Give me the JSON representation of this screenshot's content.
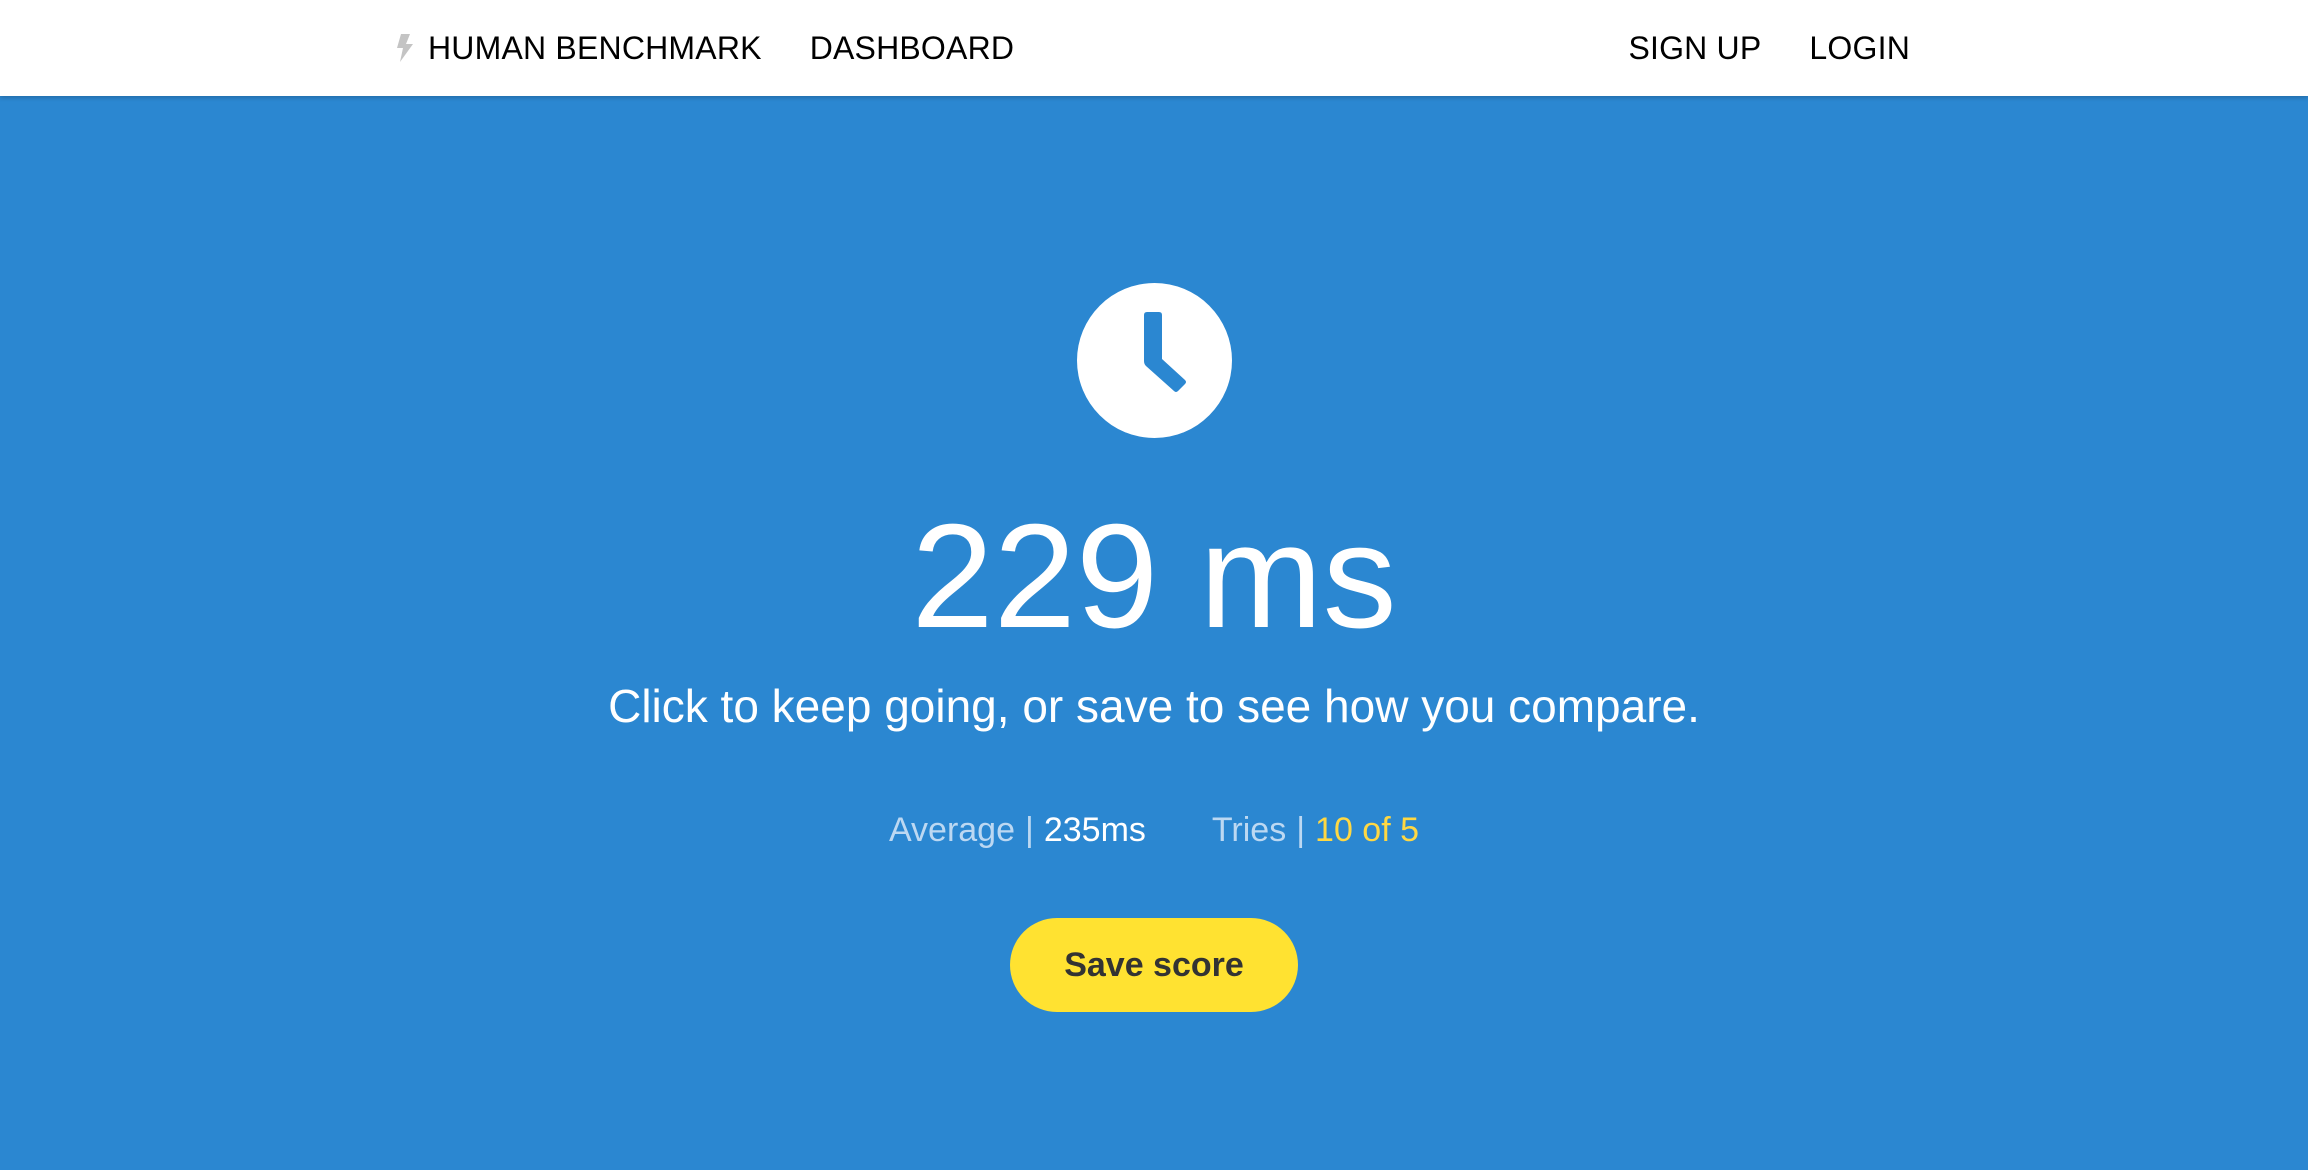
{
  "nav": {
    "brand_label": "HUMAN BENCHMARK",
    "brand_icon": "lightning-bolt-icon",
    "dashboard_label": "DASHBOARD",
    "signup_label": "SIGN UP",
    "login_label": "LOGIN"
  },
  "hero": {
    "icon": "clock-icon",
    "result": "229 ms",
    "subtitle": "Click to keep going, or save to see how you compare.",
    "stats": {
      "average_label": "Average",
      "average_value": "235ms",
      "tries_label": "Tries",
      "tries_value": "10 of 5",
      "separator": "|"
    },
    "save_label": "Save score"
  },
  "colors": {
    "background": "#2b87d1",
    "button": "#ffe231",
    "tries_highlight": "#ffd843",
    "stat_label": "#bcd8f2"
  }
}
